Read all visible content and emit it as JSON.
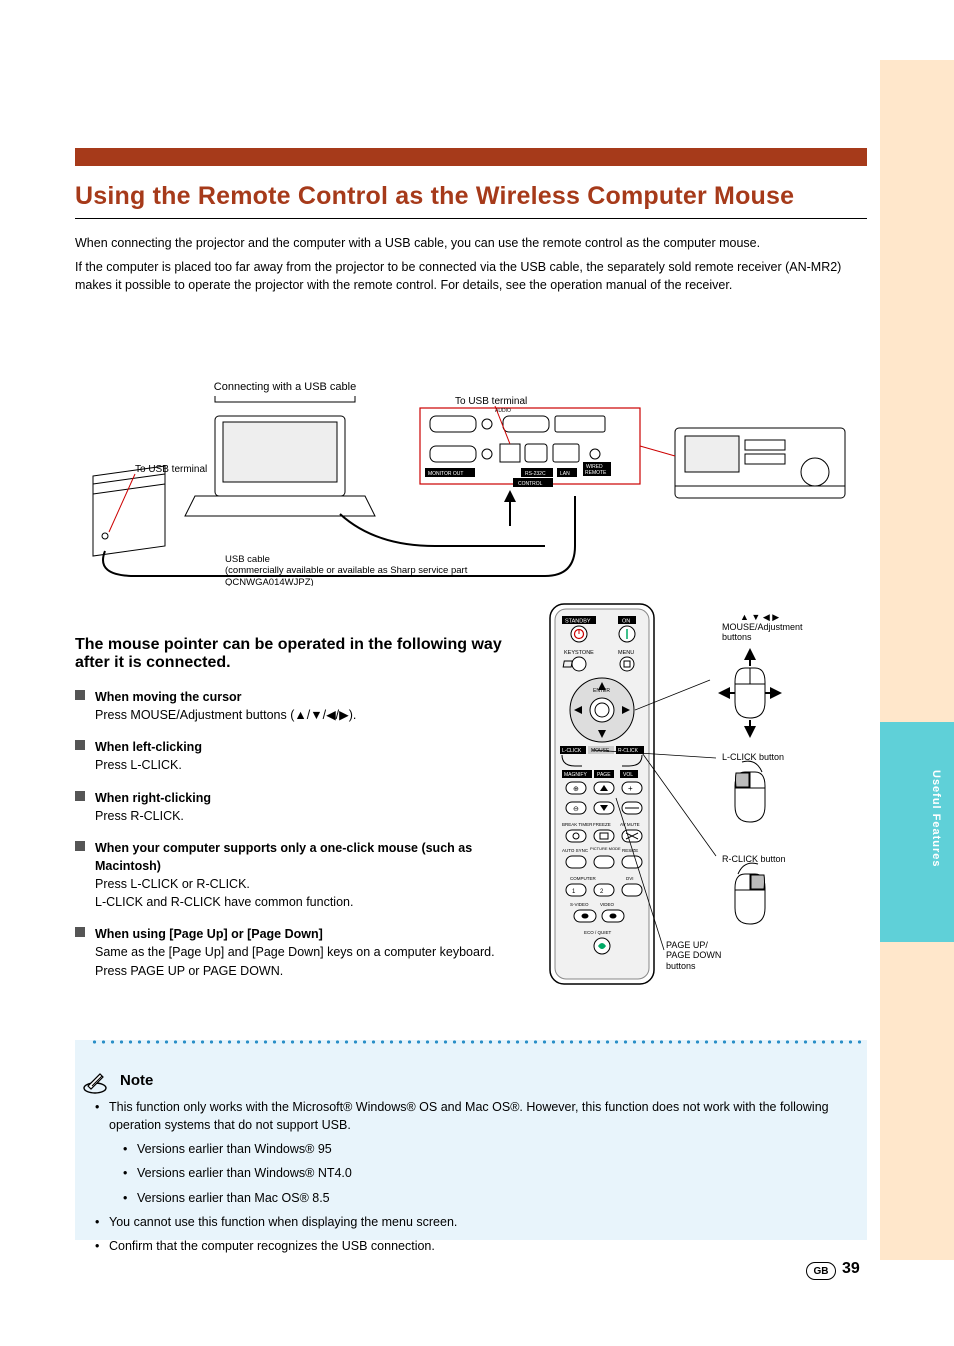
{
  "side": {
    "label": "Useful Features"
  },
  "title": "Using the Remote Control as the Wireless Computer Mouse",
  "intro": {
    "line1": "When connecting the projector and the computer with a USB cable, you can use the remote control as the computer mouse.",
    "line2": "If the computer is placed too far away from the projector to be connected via the USB cable, the separately sold remote receiver (AN-MR2) makes it possible to operate the projector with the remote control. For details, see the operation manual of the receiver."
  },
  "diagram": {
    "connecting": "Connecting with a USB cable",
    "to_usb_pc": "To USB terminal",
    "to_usb_proj": "To USB terminal",
    "usb_cable_note": "USB cable\n(commercially available or available as Sharp service part QCNWGA014WJPZ)"
  },
  "steps": {
    "header": "The mouse pointer can be operated in the following way after it is connected.",
    "move": {
      "label": "When moving the cursor",
      "desc": "Press MOUSE/Adjustment buttons (▲/▼/◀/▶)."
    },
    "left": {
      "label": "When left-clicking",
      "desc": "Press L-CLICK."
    },
    "right": {
      "label": "When right-clicking",
      "desc": "Press R-CLICK."
    },
    "onebtn": {
      "label": "When your computer supports only a one-click mouse (such as Macintosh)",
      "desc": "Press L-CLICK or R-CLICK.",
      "desc2": "L-CLICK and R-CLICK have common function."
    },
    "page": {
      "label": "When using [Page Up] or [Page Down]",
      "desc": "Same as the [Page Up] and [Page Down] keys on a computer keyboard.",
      "desc2": "Press PAGE UP or PAGE DOWN."
    }
  },
  "remote": {
    "standby": "STANDBY",
    "on": "ON",
    "keystone": "KEYSTONE",
    "menu": "MENU",
    "enter": "ENTER",
    "lclick": "L-CLICK",
    "mouse": "MOUSE",
    "rclick": "R-CLICK",
    "magnify": "MAGNIFY",
    "page": "PAGE",
    "vol": "VOL",
    "breaktimer": "BREAK TIMER",
    "freeze": "FREEZE",
    "avmute": "AV MUTE",
    "autosync": "AUTO SYNC",
    "picmode": "PICTURE MODE",
    "resize": "RESIZE",
    "computer": "COMPUTER",
    "dvi": "DVI",
    "svideo": "S-VIDEO",
    "video": "VIDEO",
    "eco": "ECO / QUIET"
  },
  "annot": {
    "arrows_label": "MOUSE/Adjustment\nbuttons",
    "lclick_label": "L-CLICK button",
    "rclick_label": "R-CLICK button",
    "page_label": "PAGE UP/\nPAGE DOWN\nbuttons"
  },
  "note": {
    "title": "Note",
    "i1": "This function only works with the Microsoft® Windows® OS and Mac OS®. However, this function does not work with the following operation systems that do not support USB.",
    "i1a": "Versions earlier than Windows® 95",
    "i1b": "Versions earlier than Windows® NT4.0",
    "i1c": "Versions earlier than Mac OS® 8.5",
    "i2": "You cannot use this function when displaying the menu screen.",
    "i3": "Confirm that the computer recognizes the USB connection."
  },
  "page_badge": "GB",
  "page_number": "39"
}
